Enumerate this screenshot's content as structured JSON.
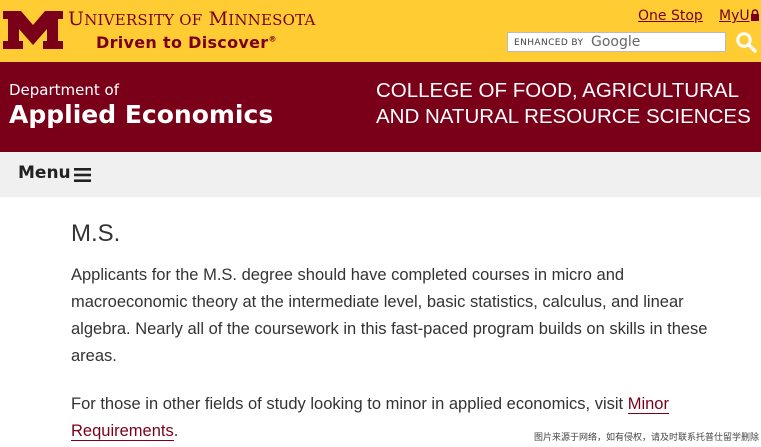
{
  "header": {
    "university_first_letter_u": "U",
    "university_rest_u": "NIVERSITY OF",
    "university_first_letter_m": "M",
    "university_rest_m": "INNESOTA",
    "tagline": "Driven to Discover",
    "tagline_mark": "®",
    "links": {
      "one_stop": "One Stop",
      "myu": "MyU"
    },
    "search": {
      "enhanced_by": "ENHANCED BY",
      "google": "Google"
    }
  },
  "department": {
    "small": "Department of",
    "big": "Applied Economics",
    "college_line1": "COLLEGE OF FOOD, AGRICULTURAL",
    "college_line2": "AND NATURAL RESOURCE SCIENCES"
  },
  "nav": {
    "menu_label": "Menu"
  },
  "content": {
    "title": "M.S.",
    "para1": "Applicants for the M.S. degree should have completed courses in micro and macroeconomic theory at the intermediate level, basic statistics, calculus, and linear algebra. Nearly all of the coursework in this fast-paced program builds on skills in these areas.",
    "para2_pre": "For those in other fields of study looking to minor in applied economics, visit ",
    "para2_link": "Minor Requirements",
    "para2_post": "."
  },
  "watermark": "图片来源于网络，如有侵权，请及时联系托普仕留学删除",
  "colors": {
    "gold": "#ffcc33",
    "maroon": "#7a0019",
    "menu_bg": "#f0f0f0"
  }
}
